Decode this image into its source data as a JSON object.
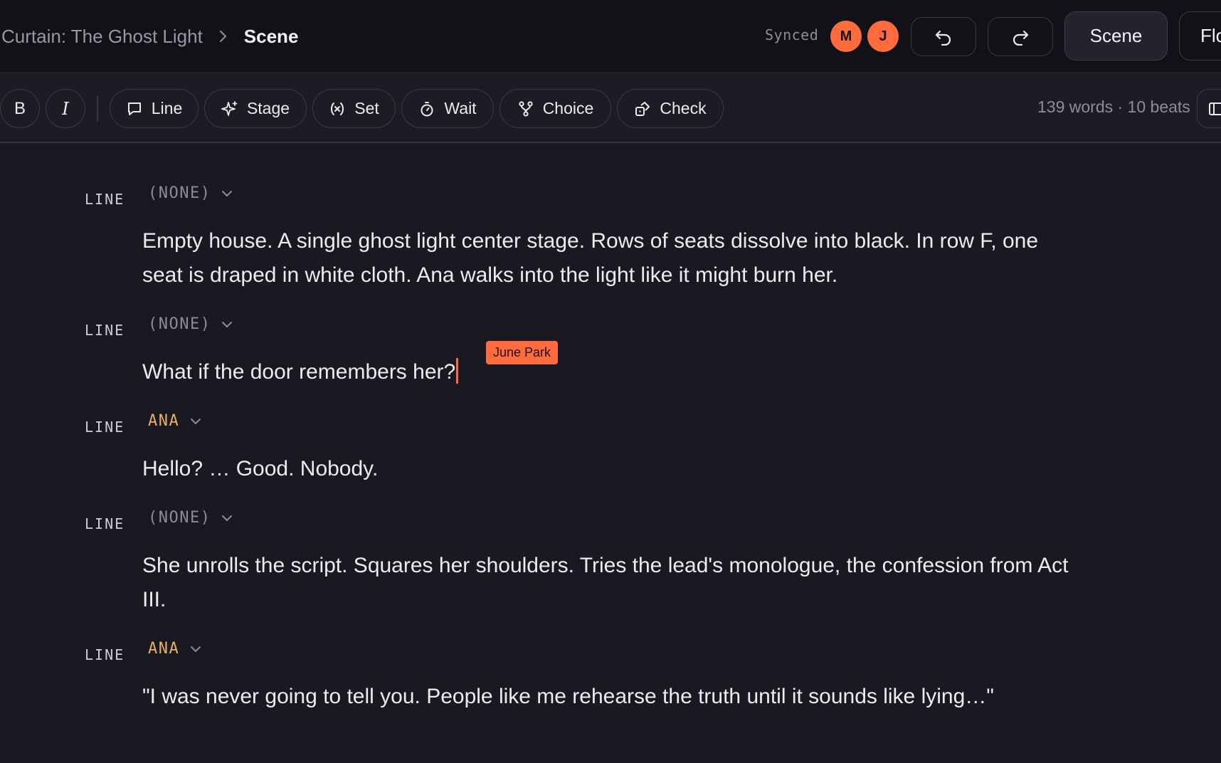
{
  "header": {
    "breadcrumb_parent": "Curtain: The Ghost Light",
    "breadcrumb_current": "Scene",
    "sync_status": "Synced",
    "avatars": [
      "M",
      "J"
    ],
    "scene_label": "Scene",
    "flow_label": "Flo"
  },
  "toolbar": {
    "bold_label": "B",
    "italic_label": "I",
    "line_label": "Line",
    "stage_label": "Stage",
    "set_label": "Set",
    "wait_label": "Wait",
    "choice_label": "Choice",
    "check_label": "Check",
    "word_count": "139 words · 10 beats"
  },
  "beats": [
    {
      "type": "LINE",
      "speaker": "(NONE)",
      "text": "Empty house. A single ghost light center stage. Rows of seats dissolve into black. In row F, one seat is draped in white cloth. Ana walks into the light like it might burn her."
    },
    {
      "type": "LINE",
      "speaker": "(NONE)",
      "text": "What if the door remembers her?"
    },
    {
      "type": "LINE",
      "speaker": "ANA",
      "text": "Hello? … Good. Nobody."
    },
    {
      "type": "LINE",
      "speaker": "(NONE)",
      "text": "She unrolls the script. Squares her shoulders. Tries the lead's monologue, the confession from Act III."
    },
    {
      "type": "LINE",
      "speaker": "ANA",
      "text": "\"I was never going to tell you. People like me rehearse the truth until it sounds like lying…\""
    }
  ],
  "collaborator_cursor": {
    "name": "June Park"
  },
  "colors": {
    "accent": "#ff6b3d",
    "speaker_character": "#e8b062",
    "speaker_none": "#8e8b98",
    "background": "#1a1921"
  }
}
